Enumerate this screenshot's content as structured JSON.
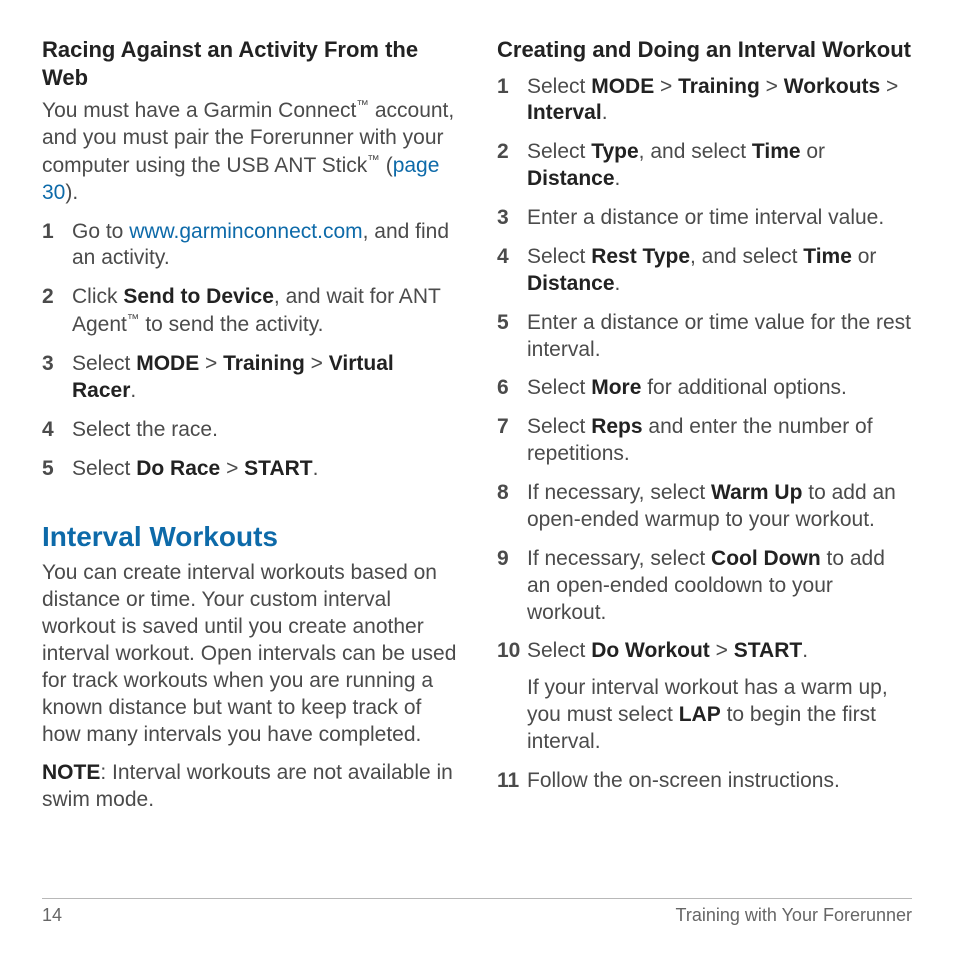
{
  "left": {
    "heading1": "Racing Against an Activity From the Web",
    "intro_before_tm1": "You must have a Garmin Connect",
    "tm": "™",
    "intro_mid": " account, and you must pair the Forerunner with your computer using the USB ANT Stick",
    "intro_after": " (",
    "page_link": "page 30",
    "intro_close": ").",
    "steps1": [
      {
        "n": "1",
        "pre": "Go to ",
        "link": "www.garminconnect.com",
        "post": ", and find an activity."
      },
      {
        "n": "2",
        "pre": "Click ",
        "b1": "Send to Device",
        "mid": ", and wait for ANT Agent",
        "tm": "™",
        "post": " to send the activity."
      },
      {
        "n": "3",
        "pre": "Select ",
        "seq": [
          "MODE",
          " > ",
          "Training",
          " > ",
          "Virtual Racer"
        ],
        "post": "."
      },
      {
        "n": "4",
        "text": "Select the race."
      },
      {
        "n": "5",
        "pre": "Select ",
        "seq": [
          "Do Race",
          " > ",
          "START"
        ],
        "post": "."
      }
    ],
    "heading2": "Interval Workouts",
    "interval_para": "You can create interval workouts based on distance or time. Your custom interval workout is saved until you create another interval workout. Open intervals can be used for track workouts when you are running a known distance but want to keep track of how many intervals you have completed.",
    "note_label": "NOTE",
    "note_text": ": Interval workouts are not available in swim mode."
  },
  "right": {
    "heading": "Creating and Doing an Interval Workout",
    "steps": [
      {
        "n": "1",
        "pre": "Select ",
        "seq": [
          "MODE",
          " > ",
          "Training",
          " > ",
          "Workouts",
          " > ",
          "Interval"
        ],
        "post": "."
      },
      {
        "n": "2",
        "pre": "Select ",
        "b1": "Type",
        "mid": ", and select ",
        "b2": "Time",
        "mid2": " or ",
        "b3": "Distance",
        "post": "."
      },
      {
        "n": "3",
        "text": "Enter a distance or time interval value."
      },
      {
        "n": "4",
        "pre": "Select ",
        "b1": "Rest Type",
        "mid": ", and select ",
        "b2": "Time",
        "mid2": " or ",
        "b3": "Distance",
        "post": "."
      },
      {
        "n": "5",
        "text": "Enter a distance or time value for the rest interval."
      },
      {
        "n": "6",
        "pre": "Select ",
        "b1": "More",
        "post": " for additional options."
      },
      {
        "n": "7",
        "pre": "Select ",
        "b1": "Reps",
        "post": " and enter the number of repetitions."
      },
      {
        "n": "8",
        "pre": "If necessary, select ",
        "b1": "Warm Up",
        "post": " to add an open-ended warmup to your workout."
      },
      {
        "n": "9",
        "pre": "If necessary, select ",
        "b1": "Cool Down",
        "post": "  to add an open-ended cooldown to your workout."
      },
      {
        "n": "10",
        "pre": "Select ",
        "seq": [
          "Do Workout",
          " > ",
          "START"
        ],
        "post": ".",
        "sub_pre": "If your interval workout has a warm up, you must select ",
        "sub_b": "LAP",
        "sub_post": " to begin the first interval."
      },
      {
        "n": "11",
        "text": "Follow the on-screen instructions."
      }
    ]
  },
  "footer": {
    "page": "14",
    "title": "Training with Your Forerunner"
  }
}
